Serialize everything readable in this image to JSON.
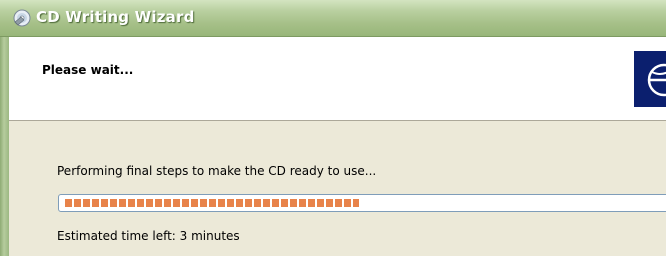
{
  "window": {
    "title": "CD Writing Wizard",
    "icon": "cd-writer-icon"
  },
  "header": {
    "title": "Please wait...",
    "logo_icon": "cd-disc-logo-icon"
  },
  "progress": {
    "status_text": "Performing final steps to make the CD ready to use...",
    "fraction": 0.485,
    "fill_color": "#e8834a",
    "eta_text": "Estimated time left: 3 minutes"
  }
}
